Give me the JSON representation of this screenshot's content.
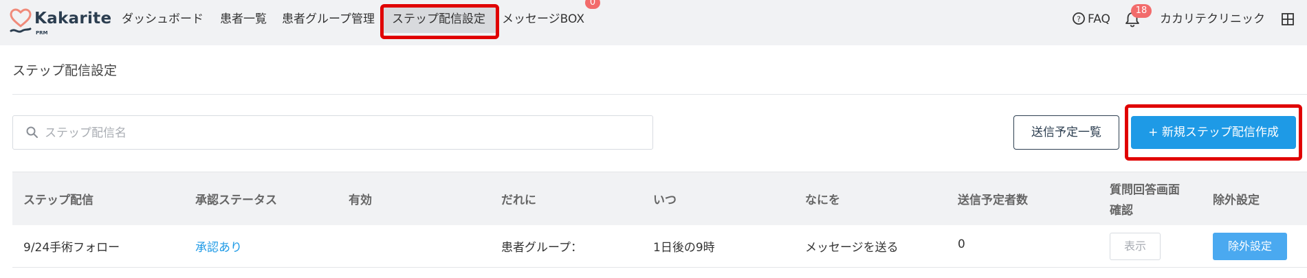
{
  "header": {
    "logo": {
      "name": "Kakarite",
      "sub": "PRM"
    },
    "nav": [
      "ダッシュボード",
      "患者一覧",
      "患者グループ管理",
      "ステップ配信設定",
      "メッセージBOX"
    ],
    "message_badge": "0",
    "faq": "FAQ",
    "notification_badge": "18",
    "clinic": "カカリテクリニック"
  },
  "page": {
    "title": "ステップ配信設定",
    "search_placeholder": "ステップ配信名",
    "schedule_button": "送信予定一覧",
    "create_button": "+ 新規ステップ配信作成"
  },
  "table": {
    "headers": {
      "name": "ステップ配信",
      "status": "承認ステータス",
      "active": "有効",
      "who": "だれに",
      "when": "いつ",
      "what": "なにを",
      "count": "送信予定者数",
      "confirm_1": "質問回答画面",
      "confirm_2": "確認",
      "exclude": "除外設定"
    },
    "rows": [
      {
        "name": "9/24手術フォロー",
        "status": "承認あり",
        "who": "患者グループ：",
        "when": "1日後の9時",
        "what": "メッセージを送る",
        "count": "0",
        "view": "表示",
        "exclude": "除外設定"
      }
    ]
  },
  "colors": {
    "accent": "#1e9ae6",
    "highlight": "#e00000",
    "badge": "#f26b6b"
  }
}
